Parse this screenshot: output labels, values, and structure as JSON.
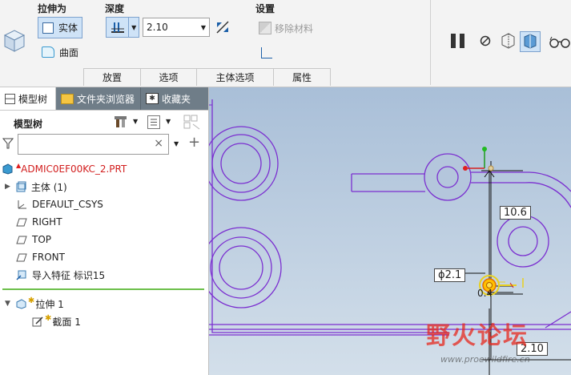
{
  "ribbon": {
    "extrude_as_label": "拉伸为",
    "solid_label": "实体",
    "surface_label": "曲面",
    "depth_label": "深度",
    "depth_value": "2.10",
    "settings_label": "设置",
    "remove_material_label": "移除材料",
    "tabs": [
      "放置",
      "选项",
      "主体选项",
      "属性"
    ]
  },
  "panel": {
    "tabs": [
      "模型树",
      "文件夹浏览器",
      "收藏夹"
    ],
    "tree_title": "模型树",
    "search_placeholder": "",
    "items": [
      {
        "label": "ADMIC0EF00KC_2.PRT",
        "icon": "part-icon"
      },
      {
        "label": "主体 (1)",
        "icon": "body-icon"
      },
      {
        "label": "DEFAULT_CSYS",
        "icon": "csys-icon"
      },
      {
        "label": "RIGHT",
        "icon": "datum-plane-icon"
      },
      {
        "label": "TOP",
        "icon": "datum-plane-icon"
      },
      {
        "label": "FRONT",
        "icon": "datum-plane-icon"
      },
      {
        "label": "导入特征 标识15",
        "icon": "import-feature-icon"
      },
      {
        "label": "拉伸 1",
        "icon": "extrude-icon"
      },
      {
        "label": "截面 1",
        "icon": "sketch-icon"
      }
    ]
  },
  "viewport": {
    "dim_vertical": "10.6",
    "dim_diameter": "ϕ2.1",
    "dim_small": "0.4",
    "dim_depth": "2.10",
    "watermark_main": "野火论坛",
    "watermark_url": "www.proewildfire.cn"
  },
  "colors": {
    "accent": "#7b2fd0",
    "panel_inactive": "#6f7d88",
    "tree_divider": "#6cbf4a",
    "error_red": "#e02020"
  }
}
